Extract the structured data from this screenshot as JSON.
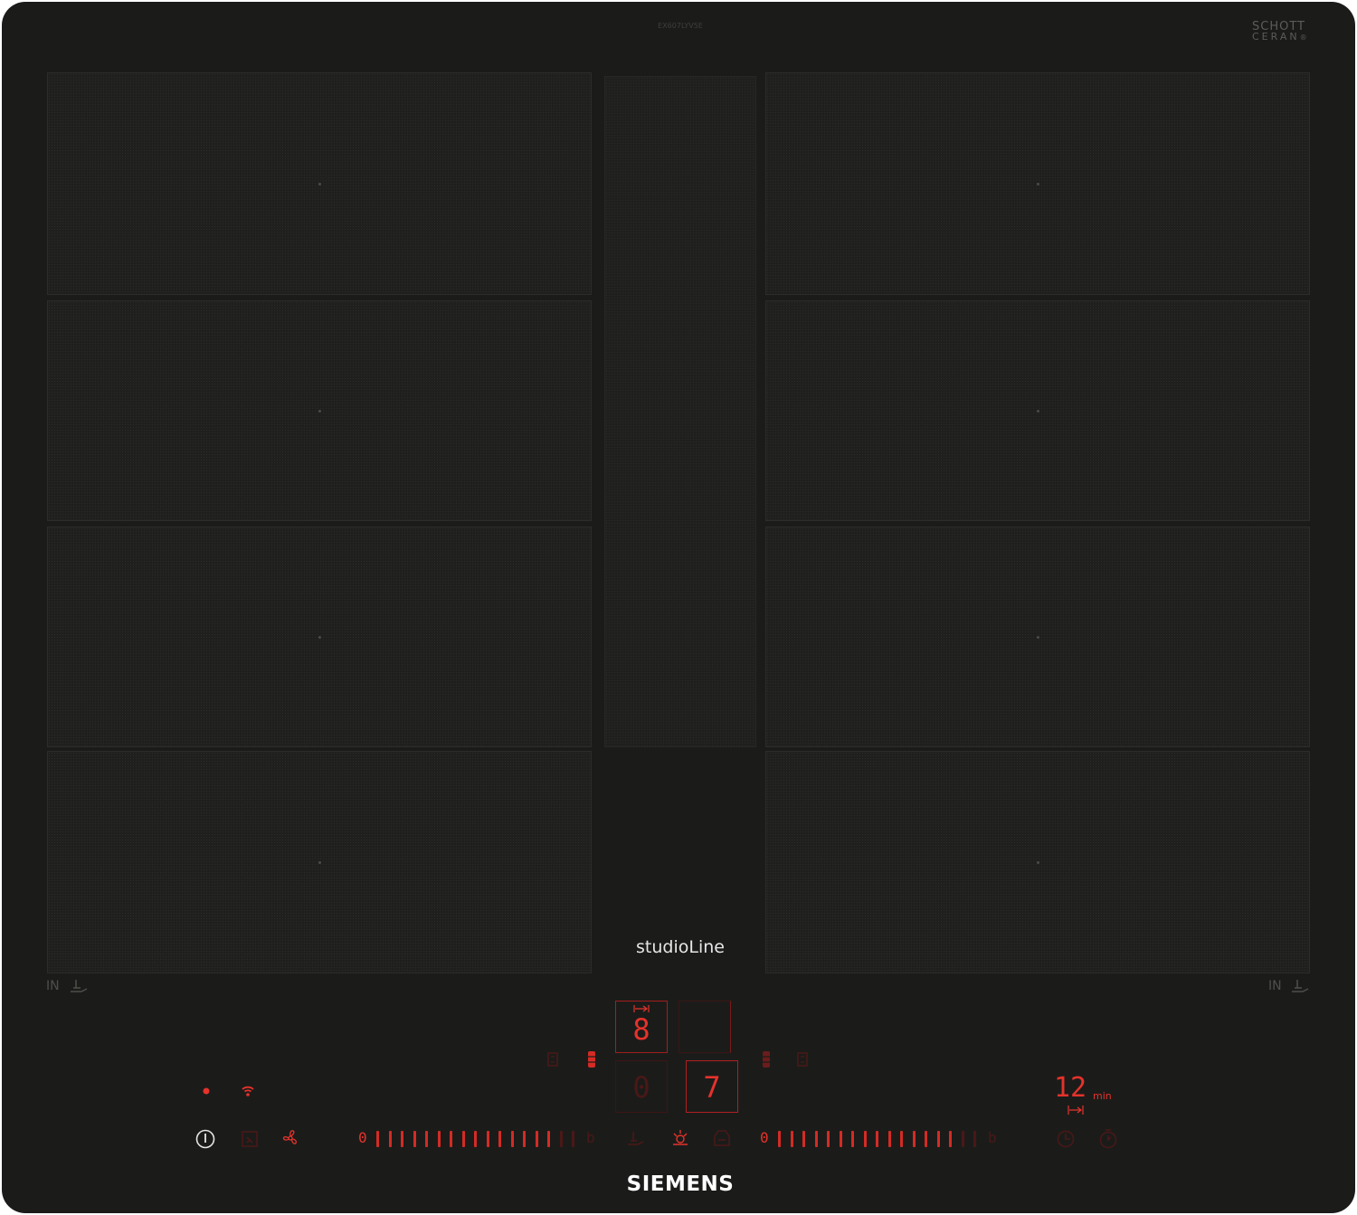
{
  "model_code": "EX607LYV5E",
  "glass_brand": {
    "line1": "SCHOTT",
    "line2": "CERAN",
    "reg": "®"
  },
  "series_label": "studioLine",
  "brand_label": "SIEMENS",
  "zones": {
    "left_label": "IN",
    "right_label": "IN"
  },
  "displays": {
    "top_left_digit": "8",
    "top_right_digit": "",
    "bottom_left_digit": "0",
    "bottom_right_digit": "7"
  },
  "sliders": {
    "left": {
      "min_label": "0",
      "max_label": "b"
    },
    "right": {
      "min_label": "0",
      "max_label": "b"
    }
  },
  "timer": {
    "value": "12",
    "unit": "min"
  },
  "colors": {
    "accent_red": "#e5322b",
    "dim_red": "#4a1817",
    "glass": "#1b1c1a"
  },
  "icons": [
    "power-icon",
    "childlock-icon",
    "fan-icon",
    "wifi-icon",
    "indicator-dot-icon",
    "frying-sensor-icon",
    "hood-light-icon",
    "hood-fan-icon",
    "clock-icon",
    "stopwatch-icon",
    "combine-zone-icon",
    "flex-zone-icon",
    "timer-arrow-icon"
  ]
}
